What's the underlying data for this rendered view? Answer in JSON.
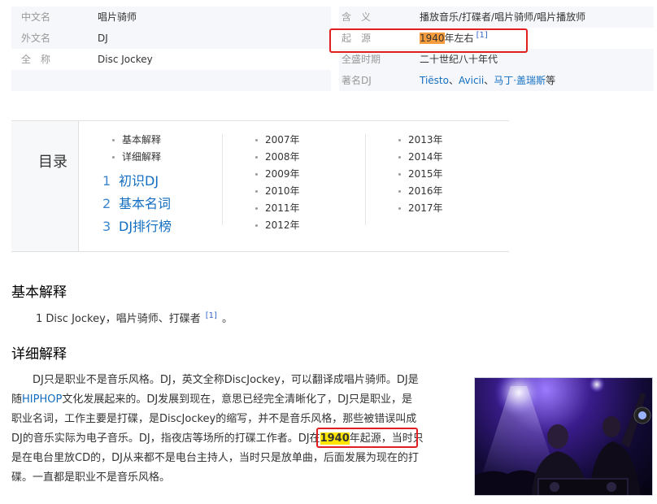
{
  "infobox": {
    "rows": [
      {
        "left_key": "中文名",
        "left_value": "唱片骑师",
        "right_key": "含　义",
        "right_value": "播放音乐/打碟者/唱片骑师/唱片播放师"
      },
      {
        "left_key": "外文名",
        "left_value": "DJ",
        "right_key": "起　源",
        "right_value_highlight": "1940",
        "right_value_rest": "年左右",
        "right_ref": "[1]"
      },
      {
        "left_key": "全　称",
        "left_value": "Disc Jockey",
        "right_key": "全盛时期",
        "right_value": "二十世纪八十年代"
      },
      {
        "right_key": "著名DJ",
        "right_links": [
          "Tiësto",
          "Avicii",
          "马丁·盖瑞斯"
        ],
        "right_seps": [
          "、",
          "、"
        ],
        "right_suffix": "等"
      }
    ]
  },
  "catalog": {
    "title": "目录",
    "sub1": [
      "基本解释",
      "详细解释"
    ],
    "main": [
      {
        "num": "1",
        "label": "初识DJ"
      },
      {
        "num": "2",
        "label": "基本名词"
      },
      {
        "num": "3",
        "label": "DJ排行榜"
      }
    ],
    "years_col2": [
      "2007年",
      "2008年",
      "2009年",
      "2010年",
      "2011年",
      "2012年"
    ],
    "years_col3": [
      "2013年",
      "2014年",
      "2015年",
      "2016年",
      "2017年"
    ]
  },
  "section_basic": {
    "heading": "基本解释",
    "text": "1 Disc Jockey，唱片骑师、打碟者",
    "ref": "[1]",
    "end": "。"
  },
  "section_detail": {
    "heading": "详细解释",
    "line1": "　　DJ只是职业不是音乐风格。DJ，英文全称DiscJockey，可以翻译成唱片骑师。DJ是",
    "line2_a": "随",
    "line2_link": "HIPHOP",
    "line2_b": "文化发展起来的。DJ发展到现在，意思已经完全清晰化了，DJ只是职业，是",
    "line3": "职业名词，工作主要是打碟，是DiscJockey的缩写，并不是音乐风格，那些被错误叫成",
    "line4_a": "DJ的音乐实际为电子音乐。DJ，指夜店等场所的打碟工作者。",
    "line4_box_a": "DJ在",
    "line4_box_hl": "1940",
    "line4_box_b": "年起源，",
    "line4_c": "当时只",
    "line5": "是在电台里放CD的，DJ从来都不是电台主持人，当时只是放单曲，后面发展为现在的打",
    "line6": "碟。一直都是职业不是音乐风格。"
  }
}
